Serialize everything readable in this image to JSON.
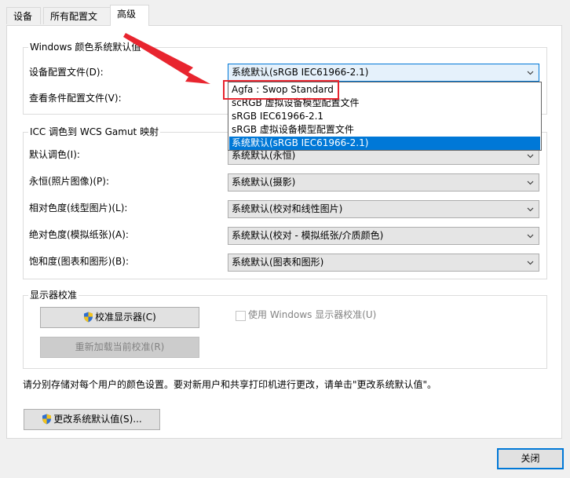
{
  "tabs": [
    {
      "label": "设备"
    },
    {
      "label": "所有配置文件"
    },
    {
      "label": "高级"
    }
  ],
  "windows_defaults": {
    "title": "Windows 颜色系统默认值",
    "device_profile_label": "设备配置文件(D):",
    "device_profile_value": "系统默认(sRGB IEC61966-2.1)",
    "viewing_conditions_label": "查看条件配置文件(V):"
  },
  "dropdown": {
    "options": [
      "Agfa : Swop Standard",
      "scRGB 虚拟设备模型配置文件",
      "sRGB IEC61966-2.1",
      "sRGB 虚拟设备模型配置文件",
      "系统默认(sRGB IEC61966-2.1)"
    ],
    "selected_index": 4
  },
  "gamut": {
    "title": "ICC 调色到 WCS Gamut 映射",
    "rows": [
      {
        "label": "默认调色(I):",
        "value": "系统默认(永恒)"
      },
      {
        "label": "永恒(照片图像)(P):",
        "value": "系统默认(摄影)"
      },
      {
        "label": "相对色度(线型图片)(L):",
        "value": "系统默认(校对和线性图片)"
      },
      {
        "label": "绝对色度(模拟纸张)(A):",
        "value": "系统默认(校对 - 模拟纸张/介质颜色)"
      },
      {
        "label": "饱和度(图表和图形)(B):",
        "value": "系统默认(图表和图形)"
      }
    ]
  },
  "calibration": {
    "title": "显示器校准",
    "calibrate_button": "校准显示器(C)",
    "reload_button": "重新加载当前校准(R)",
    "use_windows_calibration_label": "使用 Windows 显示器校准(U)",
    "use_windows_calibration_checked": false
  },
  "note": "请分别存储对每个用户的颜色设置。要对新用户和共享打印机进行更改，请单击\"更改系统默认值\"。",
  "change_defaults_button": "更改系统默认值(S)...",
  "close_button": "关闭",
  "colors": {
    "accent": "#0078d7",
    "annotation": "#e8252f"
  }
}
